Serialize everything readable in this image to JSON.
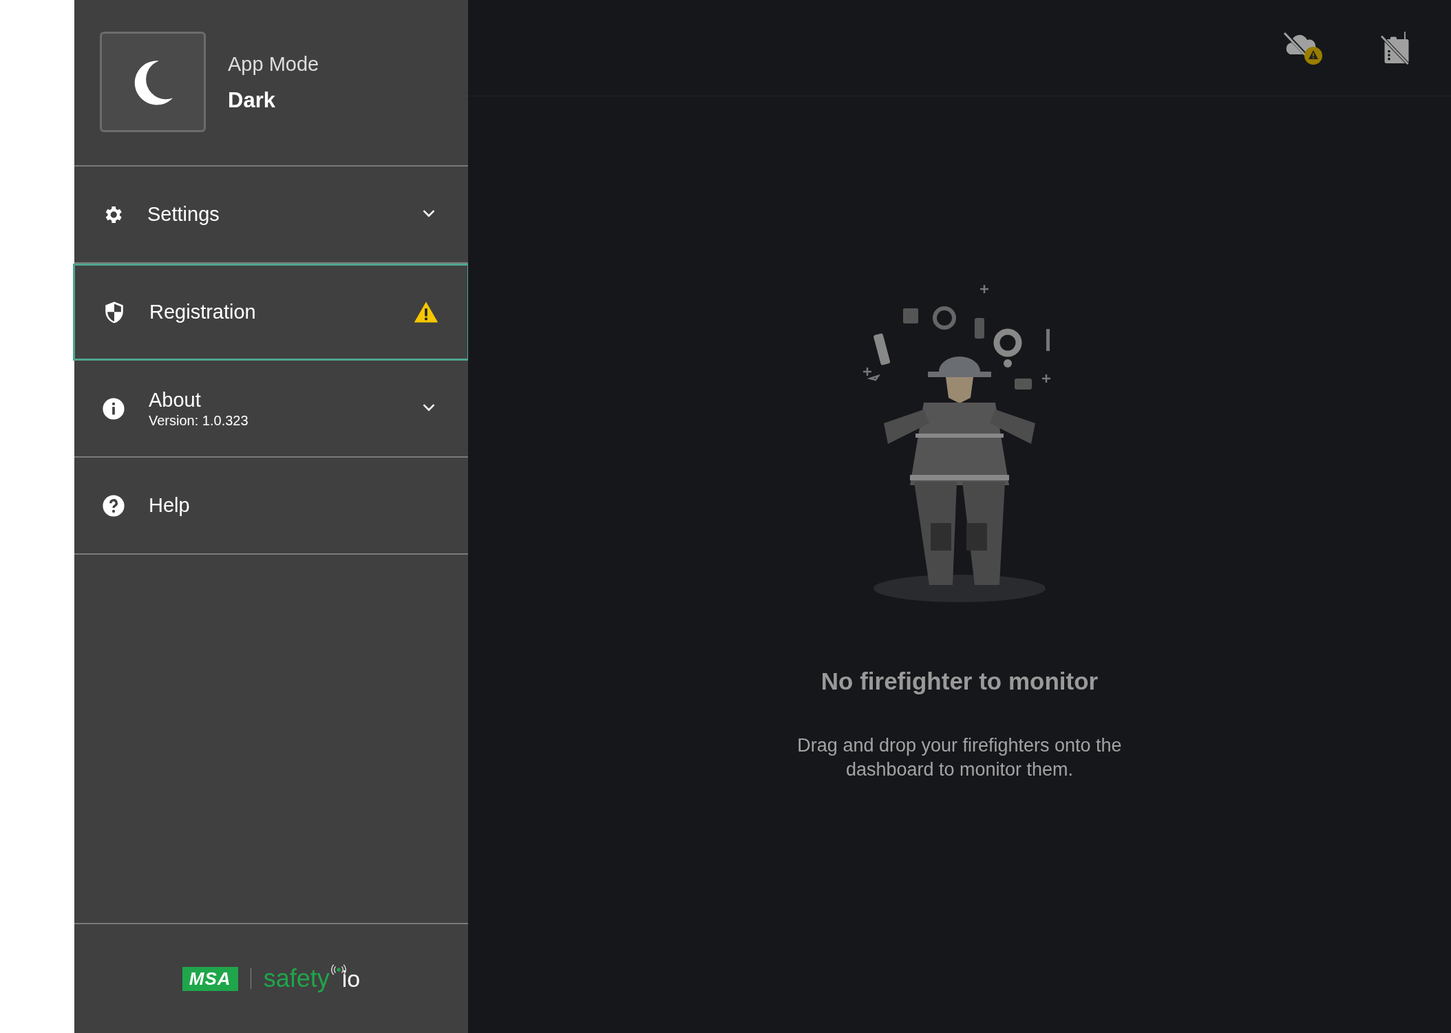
{
  "sidebar": {
    "mode": {
      "label": "App Mode",
      "value": "Dark"
    },
    "items": [
      {
        "kind": "expandable",
        "label": "Settings",
        "expanded": false,
        "selected": false
      },
      {
        "kind": "warning",
        "label": "Registration",
        "selected": true
      },
      {
        "kind": "expandable",
        "label": "About",
        "sublabel": "Version: 1.0.323",
        "expanded": false,
        "selected": false
      },
      {
        "kind": "plain",
        "label": "Help",
        "selected": false
      }
    ],
    "logo": {
      "brand": "MSA",
      "product": "safety",
      "suffix": "io"
    }
  },
  "empty_state": {
    "title": "No firefighter to monitor",
    "message": "Drag and drop your firefighters onto the dashboard to monitor them."
  }
}
